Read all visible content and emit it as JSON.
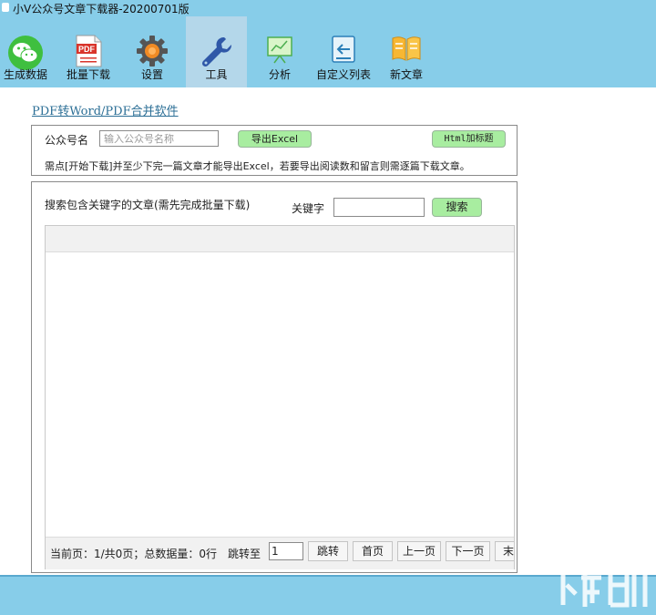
{
  "window": {
    "title": "小V公众号文章下载器-20200701版"
  },
  "toolbar": {
    "items": [
      {
        "label": "生成数据",
        "icon": "wechat-icon"
      },
      {
        "label": "批量下载",
        "icon": "pdf-icon"
      },
      {
        "label": "设置",
        "icon": "gear-icon"
      },
      {
        "label": "工具",
        "icon": "wrench-icon",
        "active": true
      },
      {
        "label": "分析",
        "icon": "chart-board-icon"
      },
      {
        "label": "自定义列表",
        "icon": "list-import-icon"
      },
      {
        "label": "新文章",
        "icon": "book-icon"
      }
    ]
  },
  "main": {
    "link_text": "PDF转Word/PDF合并软件",
    "account": {
      "label": "公众号名",
      "placeholder": "输入公众号名称",
      "export_button": "导出Excel",
      "html_button": "Html加标题",
      "notice": "需点[开始下载]并至少下完一篇文章才能导出Excel，若要导出阅读数和留言则需逐篇下载文章。"
    },
    "search": {
      "description": "搜索包含关键字的文章(需先完成批量下载)",
      "keyword_label": "关键字",
      "keyword_value": "",
      "button": "搜索"
    },
    "pager": {
      "status": "当前页：1/共0页；总数据量：0行",
      "jump_label": "跳转至",
      "page_value": "1",
      "jump_button": "跳转",
      "first": "首页",
      "prev": "上一页",
      "next": "下一页",
      "last": "末"
    }
  },
  "colors": {
    "accent": "#87cde9",
    "button_green": "#a8eda0",
    "link": "#2c6f96"
  }
}
